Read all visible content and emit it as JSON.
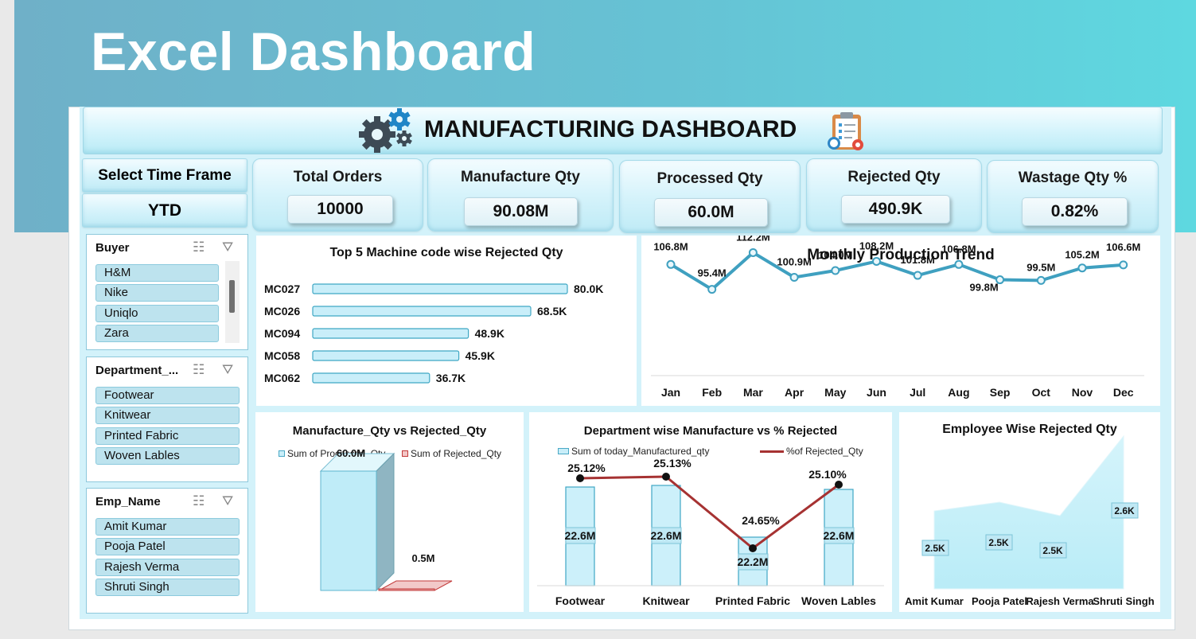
{
  "banner": {
    "title": "Excel Dashboard"
  },
  "header": {
    "title": "MANUFACTURING DASHBOARD"
  },
  "time_frame": {
    "label": "Select Time Frame",
    "value": "YTD"
  },
  "kpis": [
    {
      "label": "Total Orders",
      "value": "10000"
    },
    {
      "label": "Manufacture Qty",
      "value": "90.08M"
    },
    {
      "label": "Processed Qty",
      "value": "60.0M"
    },
    {
      "label": "Rejected Qty",
      "value": "490.9K"
    },
    {
      "label": "Wastage Qty %",
      "value": "0.82%"
    }
  ],
  "slicers": {
    "buyer": {
      "title": "Buyer",
      "items": [
        "H&M",
        "Nike",
        "Uniqlo",
        "Zara"
      ]
    },
    "department": {
      "title": "Department_...",
      "items": [
        "Footwear",
        "Knitwear",
        "Printed Fabric",
        "Woven Lables"
      ]
    },
    "employee": {
      "title": "Emp_Name",
      "items": [
        "Amit Kumar",
        "Pooja Patel",
        "Rajesh Verma",
        "Shruti Singh"
      ]
    }
  },
  "chart_data": [
    {
      "type": "bar",
      "title": "Top 5 Machine code wise Rejected Qty",
      "categories": [
        "MC027",
        "MC026",
        "MC094",
        "MC058",
        "MC062"
      ],
      "values": [
        80.0,
        68.5,
        48.9,
        45.9,
        36.7
      ],
      "labels": [
        "80.0K",
        "68.5K",
        "48.9K",
        "45.9K",
        "36.7K"
      ],
      "unit": "K",
      "xlim": [
        0,
        100
      ]
    },
    {
      "type": "line",
      "title": "Monthly Production Trend",
      "categories": [
        "Jan",
        "Feb",
        "Mar",
        "Apr",
        "May",
        "Jun",
        "Jul",
        "Aug",
        "Sep",
        "Oct",
        "Nov",
        "Dec"
      ],
      "values": [
        106.8,
        95.4,
        112.2,
        100.9,
        104.0,
        108.2,
        101.8,
        106.8,
        99.8,
        99.5,
        105.2,
        106.6
      ],
      "labels": [
        "106.8M",
        "95.4M",
        "112.2M",
        "100.9M",
        "104.0M",
        "108.2M",
        "101.8M",
        "106.8M",
        "99.8M",
        "99.5M",
        "105.2M",
        "106.6M"
      ],
      "ylim": [
        80,
        118
      ]
    },
    {
      "type": "bar",
      "title": "Manufacture_Qty vs Rejected_Qty",
      "series": [
        {
          "name": "Sum of Processed_Qty",
          "values": [
            60.0
          ],
          "label": "60.0M"
        },
        {
          "name": "Sum of Rejected_Qty",
          "values": [
            0.5
          ],
          "label": "0.5M"
        }
      ],
      "ylim": [
        0,
        60
      ]
    },
    {
      "type": "bar",
      "title": "Department wise Manufacture vs % Rejected",
      "categories": [
        "Footwear",
        "Knitwear",
        "Printed Fabric",
        "Woven Lables"
      ],
      "series": [
        {
          "name": "Sum of today_Manufactured_qty",
          "values": [
            22.6,
            22.6,
            22.2,
            22.6
          ],
          "labels": [
            "22.6M",
            "22.6M",
            "22.2M",
            "22.6M"
          ]
        },
        {
          "name": "%of Rejected_Qty",
          "type": "line",
          "values": [
            25.12,
            25.13,
            24.65,
            25.1
          ],
          "labels": [
            "25.12%",
            "25.13%",
            "24.65%",
            "25.10%"
          ]
        }
      ],
      "colors": {
        "bar": "#cdeef8",
        "line": "#a63232"
      }
    },
    {
      "type": "area",
      "title": "Employee Wise Rejected Qty",
      "categories": [
        "Amit Kumar",
        "Pooja Patel",
        "Rajesh Verma",
        "Shruti Singh"
      ],
      "values": [
        2.5,
        2.5,
        2.5,
        2.6
      ],
      "labels": [
        "2.5K",
        "2.5K",
        "2.5K",
        "2.6K"
      ]
    }
  ],
  "colors": {
    "accent": "#3fa7c4",
    "bar_fill": "#c9eef9",
    "banner": "#66c2d4",
    "reject": "#c23b3b"
  }
}
